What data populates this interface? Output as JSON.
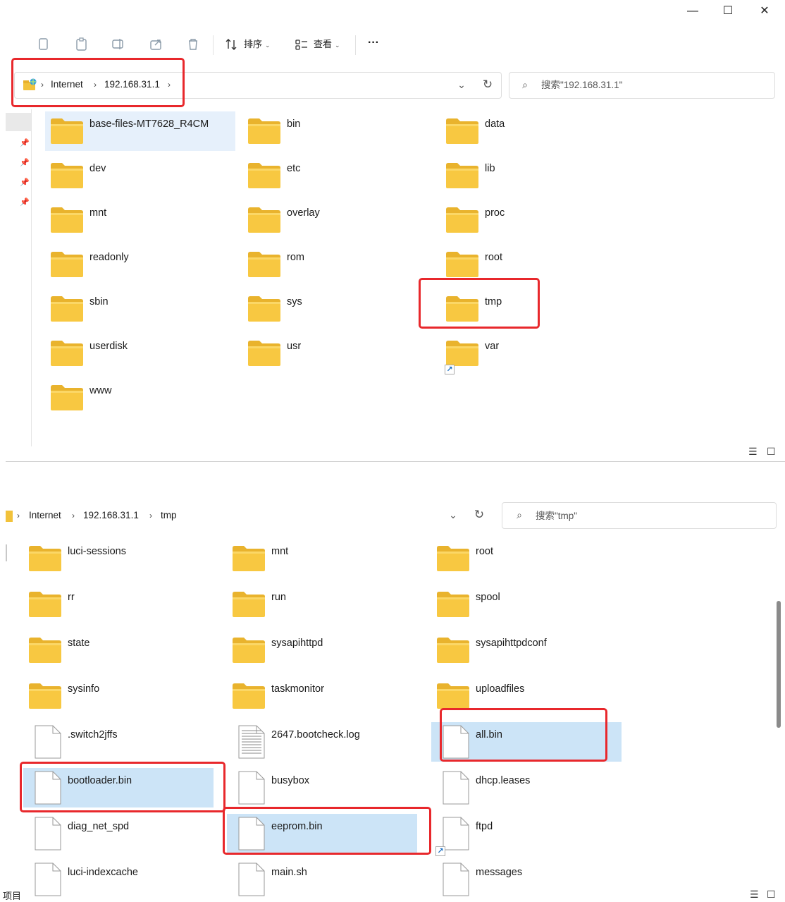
{
  "window": {
    "minimize": "—",
    "maximize": "☐",
    "close": "✕"
  },
  "toolbar": {
    "sort_label": "排序",
    "view_label": "查看",
    "more_label": "···",
    "chevron": "⌄"
  },
  "top": {
    "breadcrumb": [
      "Internet",
      "192.168.31.1"
    ],
    "search_placeholder": "搜索\"192.168.31.1\"",
    "folders": [
      "base-files-MT7628_R4CM",
      "bin",
      "data",
      "dev",
      "etc",
      "lib",
      "mnt",
      "overlay",
      "proc",
      "readonly",
      "rom",
      "root",
      "sbin",
      "sys",
      "tmp",
      "userdisk",
      "usr",
      "var",
      "www"
    ],
    "selected": "base-files-MT7628_R4CM",
    "shortcut_item": "var"
  },
  "bottom": {
    "breadcrumb": [
      "Internet",
      "192.168.31.1",
      "tmp"
    ],
    "search_placeholder": "搜索\"tmp\"",
    "folders": [
      "luci-sessions",
      "mnt",
      "root",
      "rr",
      "run",
      "spool",
      "state",
      "sysapihttpd",
      "sysapihttpdconf",
      "sysinfo",
      "taskmonitor",
      "uploadfiles"
    ],
    "files": [
      ".switch2jffs",
      "2647.bootcheck.log",
      "all.bin",
      "bootloader.bin",
      "busybox",
      "dhcp.leases",
      "diag_net_spd",
      "eeprom.bin",
      "ftpd",
      "luci-indexcache",
      "main.sh",
      "messages"
    ],
    "selected_files": [
      "all.bin",
      "bootloader.bin",
      "eeprom.bin"
    ],
    "shortcut_item": "ftpd",
    "status_text": "项目"
  },
  "colors": {
    "highlight_red": "#e8282c",
    "selection_light": "#e6f0fb",
    "selection_strong": "#cce4f7",
    "folder_yellow": "#f8c841"
  }
}
